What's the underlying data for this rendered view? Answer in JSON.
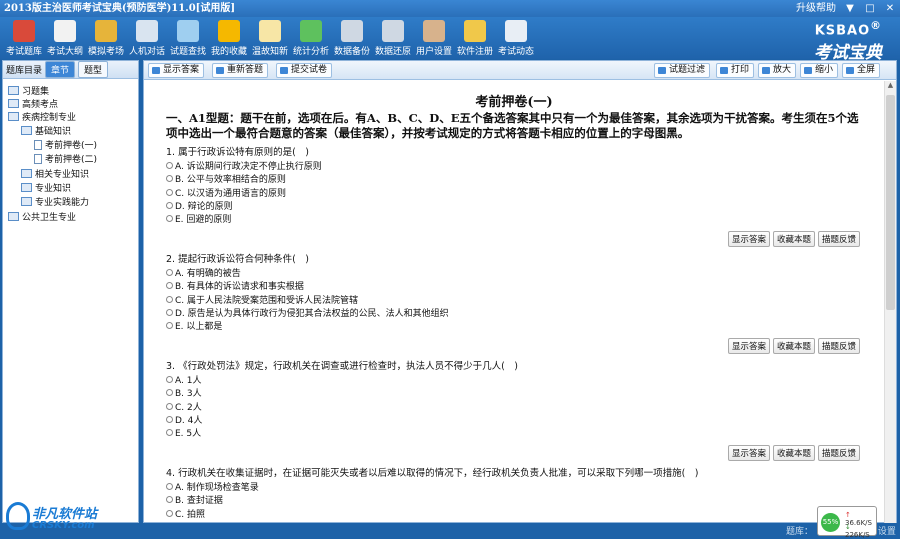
{
  "window": {
    "title": "2013版主治医师考试宝典(预防医学)11.0[试用版]",
    "upgrade_help": "升级帮助",
    "minimize": "▼",
    "maximize": "□",
    "close": "✕"
  },
  "toolbar": {
    "items": [
      {
        "label": "考试题库",
        "icon": "book-icon",
        "color": "#d94a3a"
      },
      {
        "label": "考试大纲",
        "icon": "document-icon",
        "color": "#f2f2f2"
      },
      {
        "label": "模拟考场",
        "icon": "pencil-icon",
        "color": "#e6b43a"
      },
      {
        "label": "人机对话",
        "icon": "person-icon",
        "color": "#d9e4f0"
      },
      {
        "label": "试题查找",
        "icon": "magnifier-icon",
        "color": "#9fcff0"
      },
      {
        "label": "我的收藏",
        "icon": "star-icon",
        "color": "#f5b800"
      },
      {
        "label": "温故知新",
        "icon": "lightbulb-icon",
        "color": "#f7e6a6"
      },
      {
        "label": "统计分析",
        "icon": "bar-chart-icon",
        "color": "#5ec15e"
      },
      {
        "label": "数据备份",
        "icon": "disk-icon",
        "color": "#cfd8e3"
      },
      {
        "label": "数据还原",
        "icon": "restore-icon",
        "color": "#cfd8e3"
      },
      {
        "label": "用户设置",
        "icon": "hammer-icon",
        "color": "#d7b28c"
      },
      {
        "label": "软件注册",
        "icon": "lock-icon",
        "color": "#f0c84a"
      },
      {
        "label": "考试动态",
        "icon": "news-icon",
        "color": "#e8eef5"
      }
    ],
    "logo_top": "KSBAO",
    "logo_reg": "®",
    "logo_bottom": "考试宝典"
  },
  "left_panel": {
    "header": "题库目录",
    "tab_chapter": "章节",
    "tab_type": "题型",
    "tree": [
      {
        "label": "习题集",
        "level": 0,
        "kind": "folder"
      },
      {
        "label": "高频考点",
        "level": 0,
        "kind": "folder"
      },
      {
        "label": "疾病控制专业",
        "level": 0,
        "kind": "folder"
      },
      {
        "label": "基础知识",
        "level": 1,
        "kind": "folder"
      },
      {
        "label": "考前押卷(一)",
        "level": 2,
        "kind": "doc"
      },
      {
        "label": "考前押卷(二)",
        "level": 2,
        "kind": "doc"
      },
      {
        "label": "相关专业知识",
        "level": 1,
        "kind": "folder"
      },
      {
        "label": "专业知识",
        "level": 1,
        "kind": "folder"
      },
      {
        "label": "专业实践能力",
        "level": 1,
        "kind": "folder"
      },
      {
        "label": "公共卫生专业",
        "level": 0,
        "kind": "folder"
      }
    ]
  },
  "main_toolbar": {
    "show_answer": "显示答案",
    "redo": "重新答题",
    "submit": "提交试卷",
    "filter": "试题过滤",
    "print": "打印",
    "zoom_in": "放大",
    "zoom_out": "缩小",
    "fullscreen": "全屏"
  },
  "paper": {
    "title": "考前押卷(一)",
    "instructions": "一、A1型题：题干在前，选项在后。有A、B、C、D、E五个备选答案其中只有一个为最佳答案，其余选项为干扰答案。考生须在5个选项中选出一个最符合题意的答案（最佳答案），并按考试规定的方式将答题卡相应的位置上的字母图黑。",
    "actions": [
      "显示答案",
      "收藏本题",
      "描题反馈"
    ],
    "questions": [
      {
        "stem": "1. 属于行政诉讼特有原则的是(　)",
        "options": [
          "A. 诉讼期间行政决定不停止执行原则",
          "B. 公平与效率相结合的原则",
          "C. 以汉语为通用语言的原则",
          "D. 辩论的原则",
          "E. 回避的原则"
        ]
      },
      {
        "stem": "2. 提起行政诉讼符合何种条件(　)",
        "options": [
          "A. 有明确的被告",
          "B. 有具体的诉讼请求和事实根据",
          "C. 属于人民法院受案范围和受诉人民法院管辖",
          "D. 原告是认为具体行政行为侵犯其合法权益的公民、法人和其他组织",
          "E. 以上都是"
        ]
      },
      {
        "stem": "3. 《行政处罚法》规定，行政机关在调查或进行检查时，执法人员不得少于几人(　)",
        "options": [
          "A. 1人",
          "B. 3人",
          "C. 2人",
          "D. 4人",
          "E. 5人"
        ]
      },
      {
        "stem": "4. 行政机关在收集证据时，在证据可能灭失或者以后难以取得的情况下，经行政机关负责人批准，可以采取下列哪一项措施(　)",
        "options": [
          "A. 制作现场检查笔录",
          "B. 查封证据",
          "C. 拍照"
        ]
      }
    ]
  },
  "status": {
    "text": "题库：",
    "settings": "设置",
    "net_percent": "55%",
    "upload": "36.6K/S",
    "download": "226K/S"
  },
  "watermark": {
    "site_cn": "非凡软件站",
    "site_en": "CRSKY.com"
  }
}
